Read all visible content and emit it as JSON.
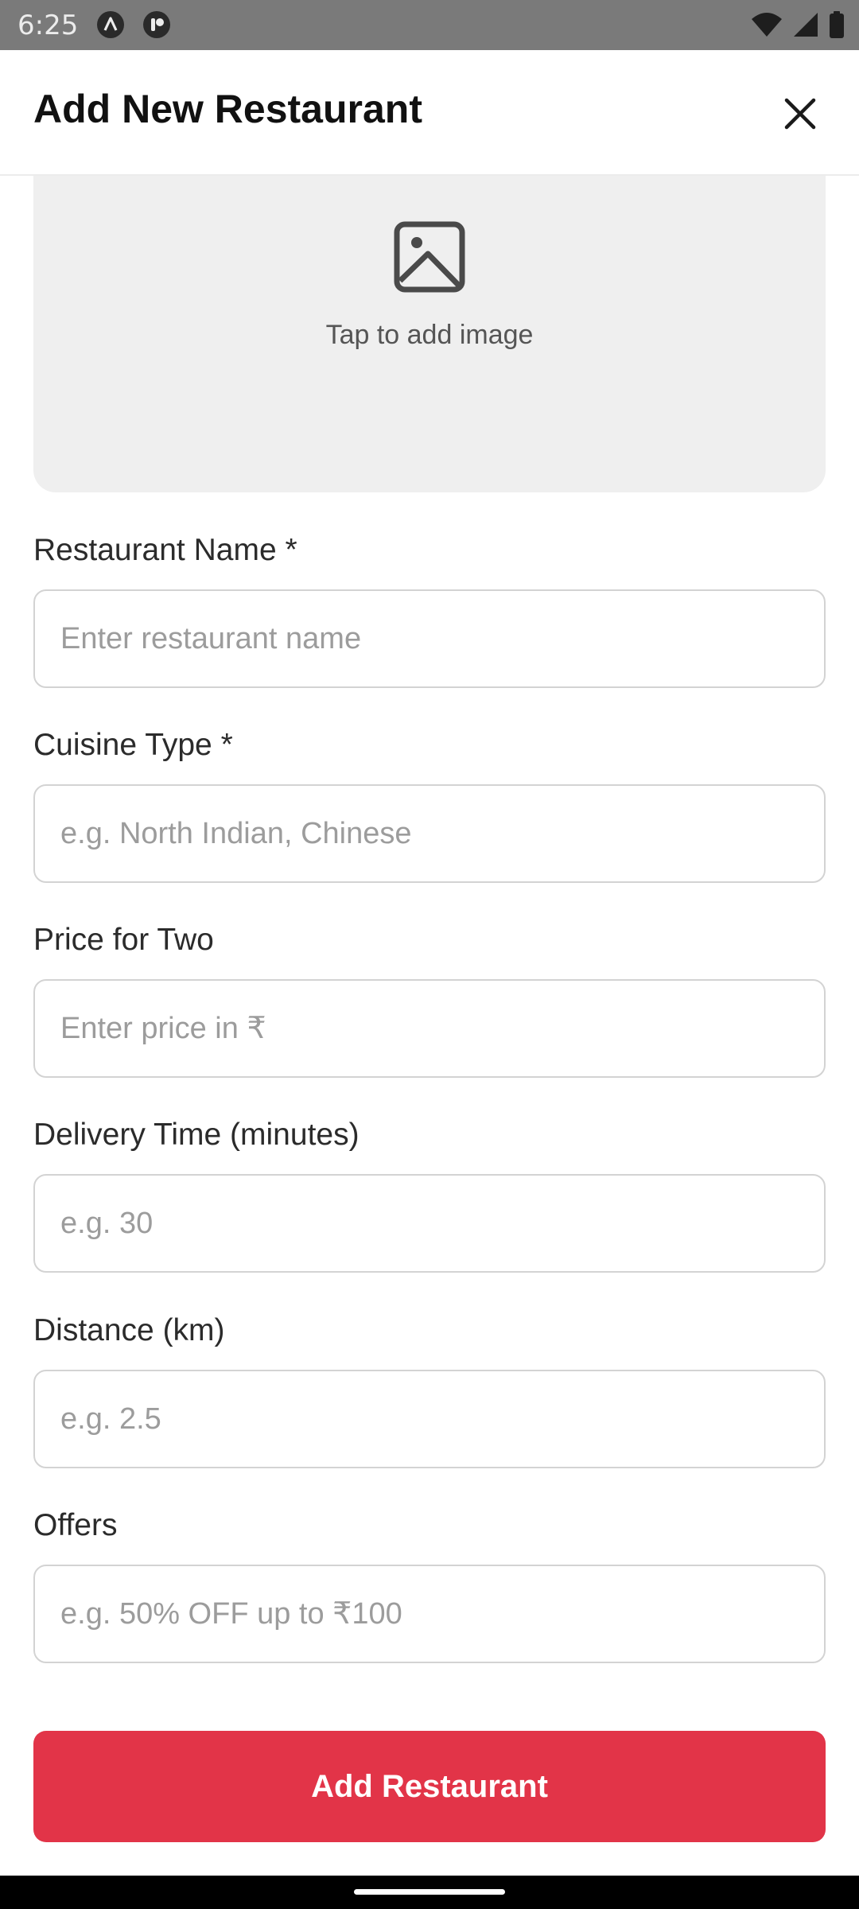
{
  "status_bar": {
    "time": "6:25",
    "icons": [
      "app-a-icon",
      "app-b-icon",
      "wifi-icon",
      "signal-icon",
      "battery-icon"
    ]
  },
  "header": {
    "title": "Add New Restaurant",
    "close_icon": "close-icon"
  },
  "image_picker": {
    "icon": "image-icon",
    "caption": "Tap to add image"
  },
  "form": {
    "fields": [
      {
        "label": "Restaurant Name *",
        "placeholder": "Enter restaurant name",
        "value": ""
      },
      {
        "label": "Cuisine Type *",
        "placeholder": "e.g. North Indian, Chinese",
        "value": ""
      },
      {
        "label": "Price for Two",
        "placeholder": "Enter price in ₹",
        "value": ""
      },
      {
        "label": "Delivery Time (minutes)",
        "placeholder": "e.g. 30",
        "value": ""
      },
      {
        "label": "Distance (km)",
        "placeholder": "e.g. 2.5",
        "value": ""
      },
      {
        "label": "Offers",
        "placeholder": "e.g. 50% OFF up to ₹100",
        "value": ""
      }
    ]
  },
  "submit": {
    "label": "Add Restaurant"
  },
  "colors": {
    "accent": "#e23448",
    "status_bar": "#7a7a7a",
    "picker_bg": "#efefef",
    "input_border": "#d3d3d3",
    "placeholder": "#9c9c9c"
  }
}
